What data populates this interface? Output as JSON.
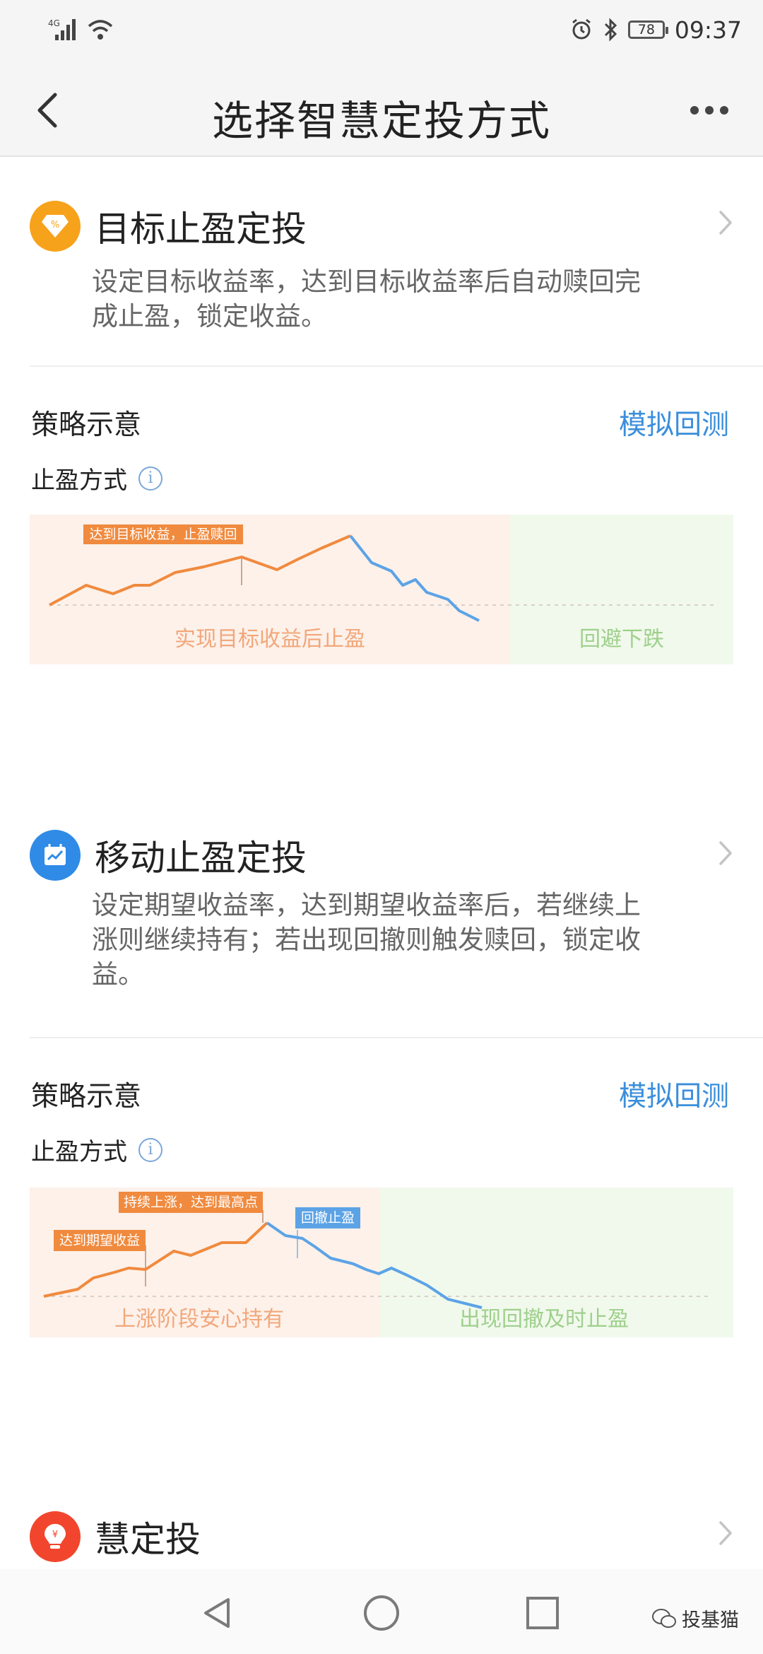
{
  "status_bar": {
    "network": "4G",
    "time": "09:37",
    "battery": "78"
  },
  "header": {
    "title": "选择智慧定投方式"
  },
  "plans": [
    {
      "title": "目标止盈定投",
      "description_line1": "设定目标收益率，达到目标收益率后自动赎回完",
      "description_line2": "成止盈，锁定收益。",
      "icon": "diamond-percent-icon",
      "icon_color": "#f7a21b",
      "strategy_label": "策略示意",
      "backtest_label": "模拟回测",
      "mode_label": "止盈方式",
      "chart": {
        "tag": "达到目标收益，止盈赎回",
        "zone_left_label": "实现目标收益后止盈",
        "zone_right_label": "回避下跌"
      }
    },
    {
      "title": "移动止盈定投",
      "description_line1": "设定期望收益率，达到期望收益率后，若继续上",
      "description_line2": "涨则继续持有；若出现回撤则触发赎回，锁定收",
      "description_line3": "益。",
      "icon": "trend-chart-icon",
      "icon_color": "#2f8be6",
      "strategy_label": "策略示意",
      "backtest_label": "模拟回测",
      "mode_label": "止盈方式",
      "chart": {
        "tag_expected": "达到期望收益",
        "tag_peak": "持续上涨，达到最高点",
        "tag_pullback": "回撤止盈",
        "zone_left_label": "上涨阶段安心持有",
        "zone_right_label": "出现回撤及时止盈"
      }
    },
    {
      "title": "慧定投",
      "icon": "lightbulb-yen-icon",
      "icon_color": "#f1462d"
    }
  ],
  "colors": {
    "accent": "#3a8edb",
    "orange": "#f08a3e",
    "blue": "#5ca3e6",
    "green_text": "#9ed08c"
  },
  "watermark": {
    "text": "投基猫"
  }
}
